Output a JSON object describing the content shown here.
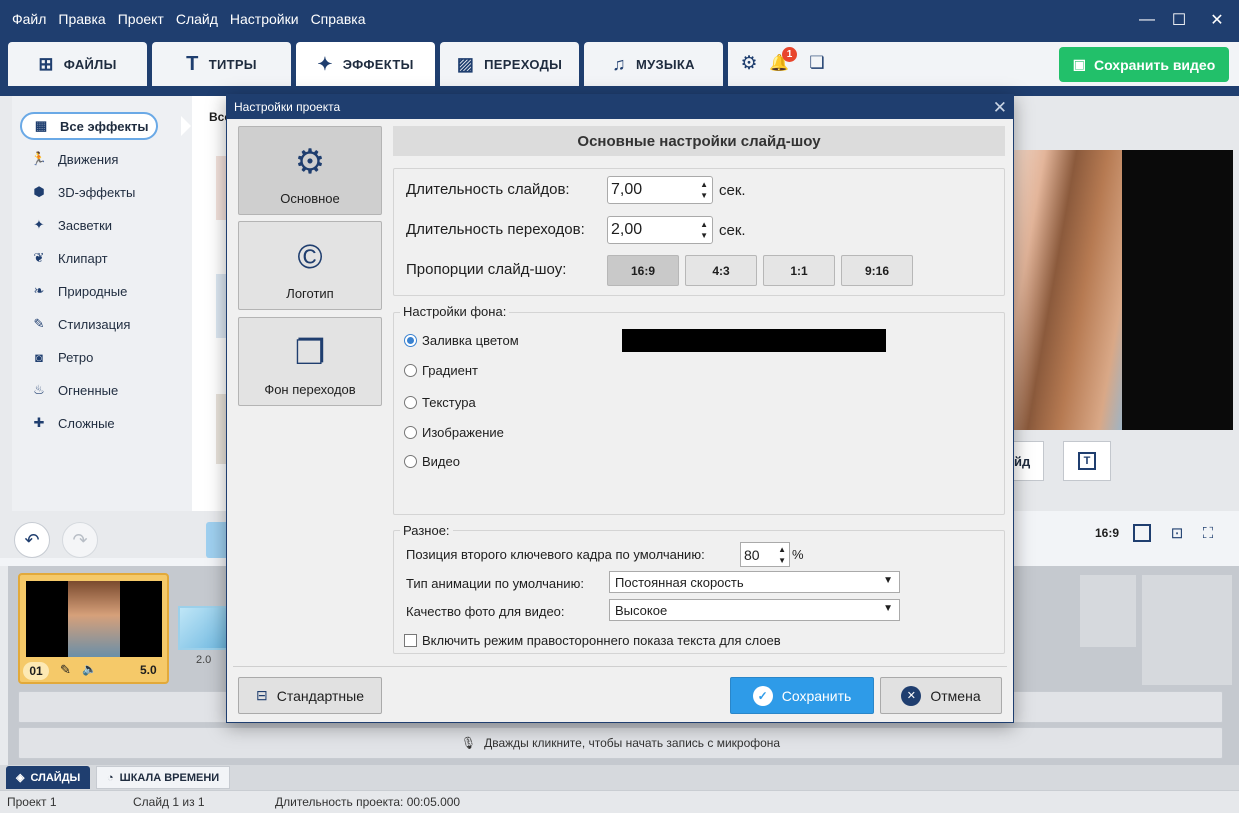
{
  "menu": [
    "Файл",
    "Правка",
    "Проект",
    "Слайд",
    "Настройки",
    "Справка"
  ],
  "window_controls": {
    "minimize": "—",
    "maximize": "☐",
    "close": "✕"
  },
  "tabs": [
    {
      "label": "ФАЙЛЫ",
      "icon": "add-media-icon",
      "glyph": "⊞"
    },
    {
      "label": "ТИТРЫ",
      "icon": "text-icon",
      "glyph": "T"
    },
    {
      "label": "ЭФФЕКТЫ",
      "icon": "effects-star-icon",
      "glyph": "✦"
    },
    {
      "label": "ПЕРЕХОДЫ",
      "icon": "transitions-icon",
      "glyph": "▨"
    },
    {
      "label": "МУЗЫКА",
      "icon": "music-note-icon",
      "glyph": "♫"
    }
  ],
  "notification_count": "1",
  "save_video_label": "Сохранить видео",
  "categories": [
    {
      "label": "Все эффекты",
      "glyph": "▦",
      "icon": "grid-icon"
    },
    {
      "label": "Движения",
      "glyph": "🏃",
      "icon": "running-icon"
    },
    {
      "label": "3D-эффекты",
      "glyph": "⬢",
      "icon": "cube-icon"
    },
    {
      "label": "Засветки",
      "glyph": "✦",
      "icon": "sparkle-icon"
    },
    {
      "label": "Клипарт",
      "glyph": "❦",
      "icon": "clipart-icon"
    },
    {
      "label": "Природные",
      "glyph": "❧",
      "icon": "leaf-icon"
    },
    {
      "label": "Стилизация",
      "glyph": "✎",
      "icon": "brush-icon"
    },
    {
      "label": "Ретро",
      "glyph": "◙",
      "icon": "camera-icon"
    },
    {
      "label": "Огненные",
      "glyph": "♨",
      "icon": "flame-icon"
    },
    {
      "label": "Сложные",
      "glyph": "✚",
      "icon": "puzzle-icon"
    }
  ],
  "effects_header_partial": "Все",
  "preview": {
    "slide_button_partial": "йд",
    "aspect": "16:9"
  },
  "timeline": {
    "slide_number": "01",
    "slide_duration": "5.0",
    "transition_duration": "2.0",
    "mic_hint": "Дважды кликните, чтобы начать запись с микрофона"
  },
  "bottom_tabs": [
    "СЛАЙДЫ",
    "ШКАЛА ВРЕМЕНИ"
  ],
  "status": {
    "project": "Проект 1",
    "slide": "Слайд 1 из 1",
    "duration": "Длительность проекта: 00:05.000"
  },
  "dialog": {
    "title": "Настройки проекта",
    "side_buttons": [
      {
        "label": "Основное",
        "icon": "gear-icon",
        "glyph": "⚙"
      },
      {
        "label": "Логотип",
        "icon": "copyright-icon",
        "glyph": "©"
      },
      {
        "label": "Фон переходов",
        "icon": "layers-icon",
        "glyph": "❐"
      }
    ],
    "header": "Основные настройки слайд-шоу",
    "slide_duration_label": "Длительность слайдов:",
    "slide_duration_value": "7,00",
    "transition_duration_label": "Длительность переходов:",
    "transition_duration_value": "2,00",
    "unit": "сек.",
    "aspect_label": "Пропорции слайд-шоу:",
    "aspect_options": [
      "16:9",
      "4:3",
      "1:1",
      "9:16"
    ],
    "aspect_selected": "16:9",
    "bg_group_label": "Настройки фона:",
    "bg_options": [
      "Заливка цветом",
      "Градиент",
      "Текстура",
      "Изображение",
      "Видео"
    ],
    "bg_selected": "Заливка цветом",
    "fill_color": "#000000",
    "misc_group_label": "Разное:",
    "keyframe_label": "Позиция второго ключевого кадра по умолчанию:",
    "keyframe_value": "80",
    "keyframe_unit": "%",
    "anim_label": "Тип анимации по умолчанию:",
    "anim_value": "Постоянная скорость",
    "quality_label": "Качество фото для видео:",
    "quality_value": "Высокое",
    "rtl_label": "Включить режим правостороннего показа текста для слоев",
    "btn_default": "Стандартные",
    "btn_save": "Сохранить",
    "btn_cancel": "Отмена"
  },
  "colors": {
    "brand": "#1f3e6f",
    "save_green": "#22c06a",
    "save_blue": "#2e9be8",
    "slide_yellow": "#f5c969"
  }
}
